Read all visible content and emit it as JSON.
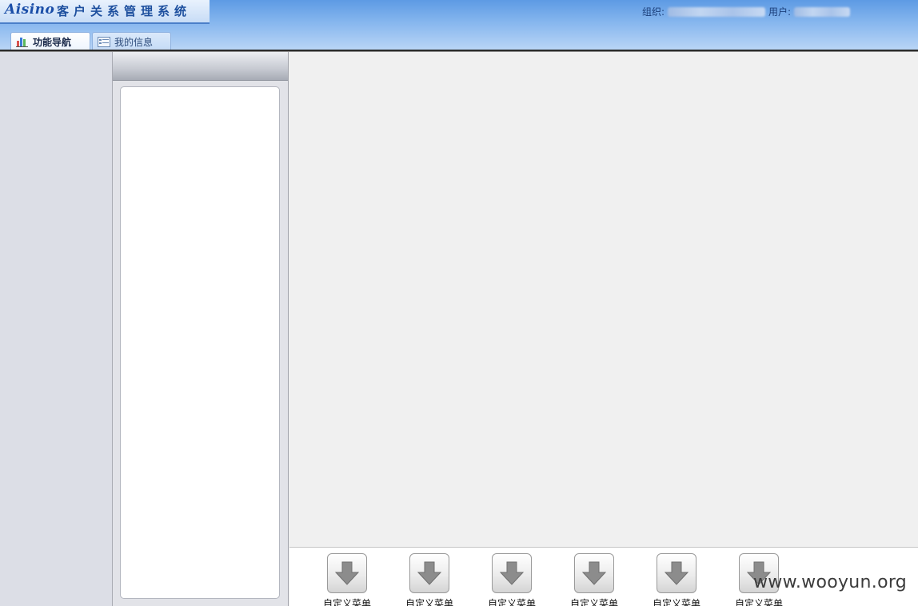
{
  "header": {
    "logo_brand": "Aisino",
    "logo_title": "客户关系管理系统",
    "org_label": "组织:",
    "user_label": "用户:"
  },
  "tabs": [
    {
      "label": "功能导航",
      "icon": "bar-chart-icon"
    },
    {
      "label": "我的信息",
      "icon": "list-card-icon"
    }
  ],
  "custom_menus": [
    {
      "label": "自定义菜单",
      "icon": "down-arrow-icon"
    },
    {
      "label": "自定义菜单",
      "icon": "down-arrow-icon"
    },
    {
      "label": "自定义菜单",
      "icon": "down-arrow-icon"
    },
    {
      "label": "自定义菜单",
      "icon": "down-arrow-icon"
    },
    {
      "label": "自定义菜单",
      "icon": "down-arrow-icon"
    },
    {
      "label": "自定义菜单",
      "icon": "down-arrow-icon"
    }
  ],
  "watermark": "www.wooyun.org",
  "colors": {
    "header_top": "#5d9ae4",
    "header_bottom": "#b9d5f6",
    "sidebar": "#dcdee6",
    "main_bg": "#f0f0f0"
  }
}
